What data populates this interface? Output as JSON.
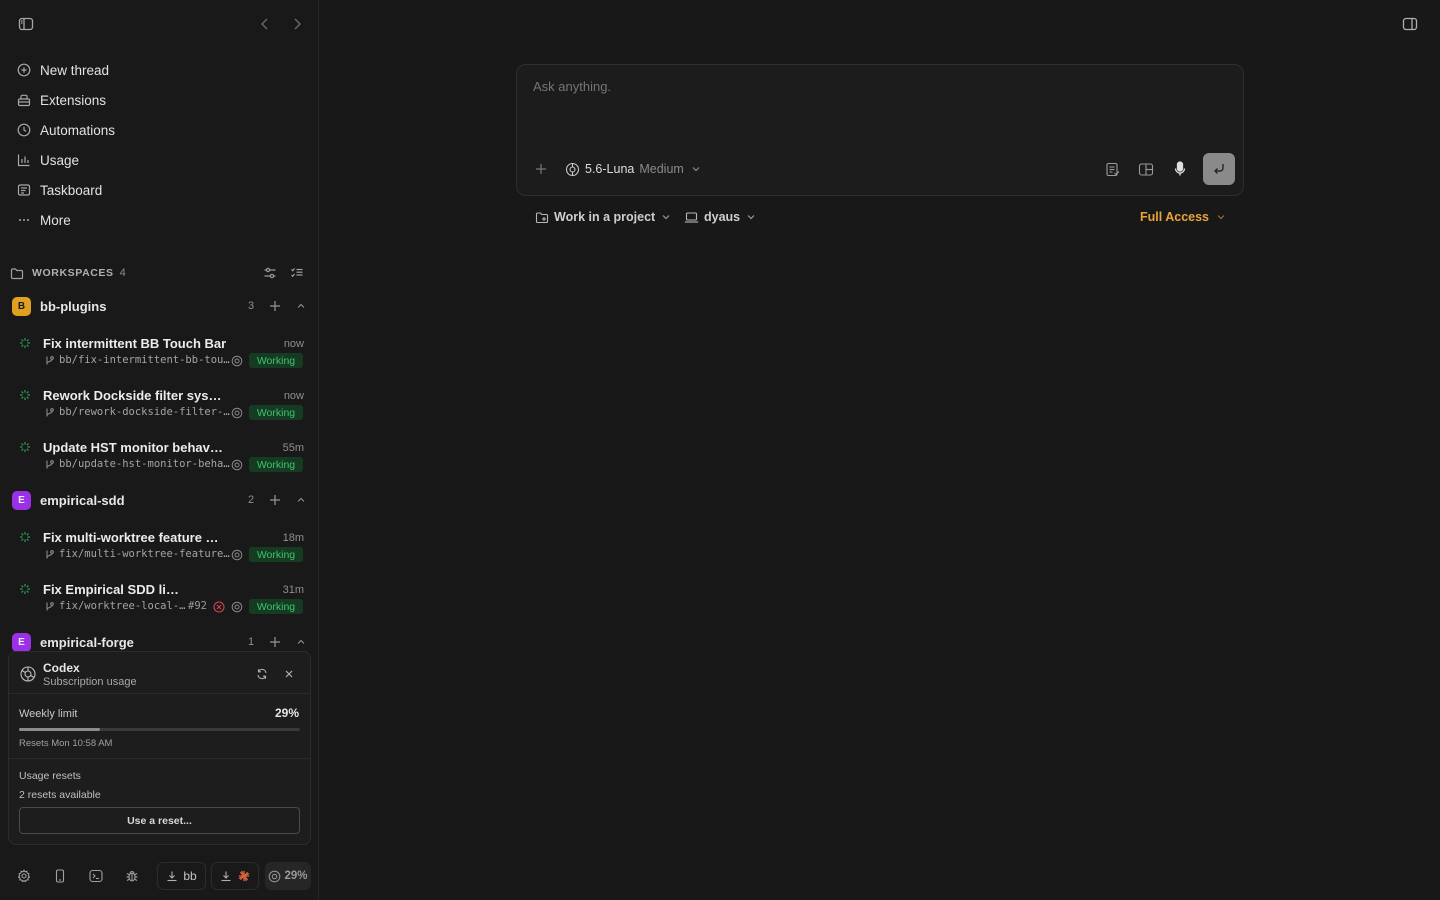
{
  "sidebar": {
    "nav": [
      {
        "label": "New thread",
        "icon": "plus-circle-icon"
      },
      {
        "label": "Extensions",
        "icon": "extensions-icon"
      },
      {
        "label": "Automations",
        "icon": "clock-icon"
      },
      {
        "label": "Usage",
        "icon": "bar-chart-icon"
      },
      {
        "label": "Taskboard",
        "icon": "taskboard-icon"
      },
      {
        "label": "More",
        "icon": "ellipsis-icon"
      }
    ],
    "workspaces": {
      "label": "WORKSPACES",
      "count": "4",
      "groups": [
        {
          "badge": "B",
          "badge_color": "#e0a020",
          "name": "bb-plugins",
          "count": "3",
          "threads": [
            {
              "title": "Fix intermittent BB Touch Bar",
              "time": "now",
              "branch": "bb/fix-intermittent-bb-tou…",
              "status": "Working"
            },
            {
              "title": "Rework Dockside filter sys…",
              "time": "now",
              "branch": "bb/rework-dockside-filter-…",
              "status": "Working"
            },
            {
              "title": "Update HST monitor behav…",
              "time": "55m",
              "branch": "bb/update-hst-monitor-beha…",
              "status": "Working"
            }
          ]
        },
        {
          "badge": "E",
          "badge_color": "#9b30e6",
          "name": "empirical-sdd",
          "count": "2",
          "threads": [
            {
              "title": "Fix multi-worktree feature …",
              "time": "18m",
              "branch": "fix/multi-worktree-feature…",
              "status": "Working"
            },
            {
              "title": "Fix Empirical SDD li…",
              "time": "31m",
              "branch": "fix/worktree-local-…",
              "pr": "#92",
              "status": "Working"
            }
          ]
        },
        {
          "badge": "E",
          "badge_color": "#9b30e6",
          "name": "empirical-forge",
          "count": "1"
        }
      ]
    },
    "usage_card": {
      "title": "Codex",
      "subtitle": "Subscription usage",
      "weekly_label": "Weekly limit",
      "weekly_percent": "29%",
      "weekly_fraction": 0.29,
      "resets_text": "Resets Mon 10:58 AM",
      "usage_resets_label": "Usage resets",
      "resets_available": "2 resets available",
      "reset_button": "Use a reset..."
    },
    "footer": {
      "bb_label": "bb",
      "usage_percent": "29%"
    }
  },
  "composer": {
    "placeholder": "Ask anything.",
    "model": "5.6-Luna",
    "effort": "Medium"
  },
  "subbar": {
    "project": "Work in a project",
    "machine": "dyaus",
    "access": "Full Access"
  },
  "colors": {
    "accent_access": "#e8a33a",
    "working_text": "#3fc46a",
    "working_bg": "#163b23"
  }
}
